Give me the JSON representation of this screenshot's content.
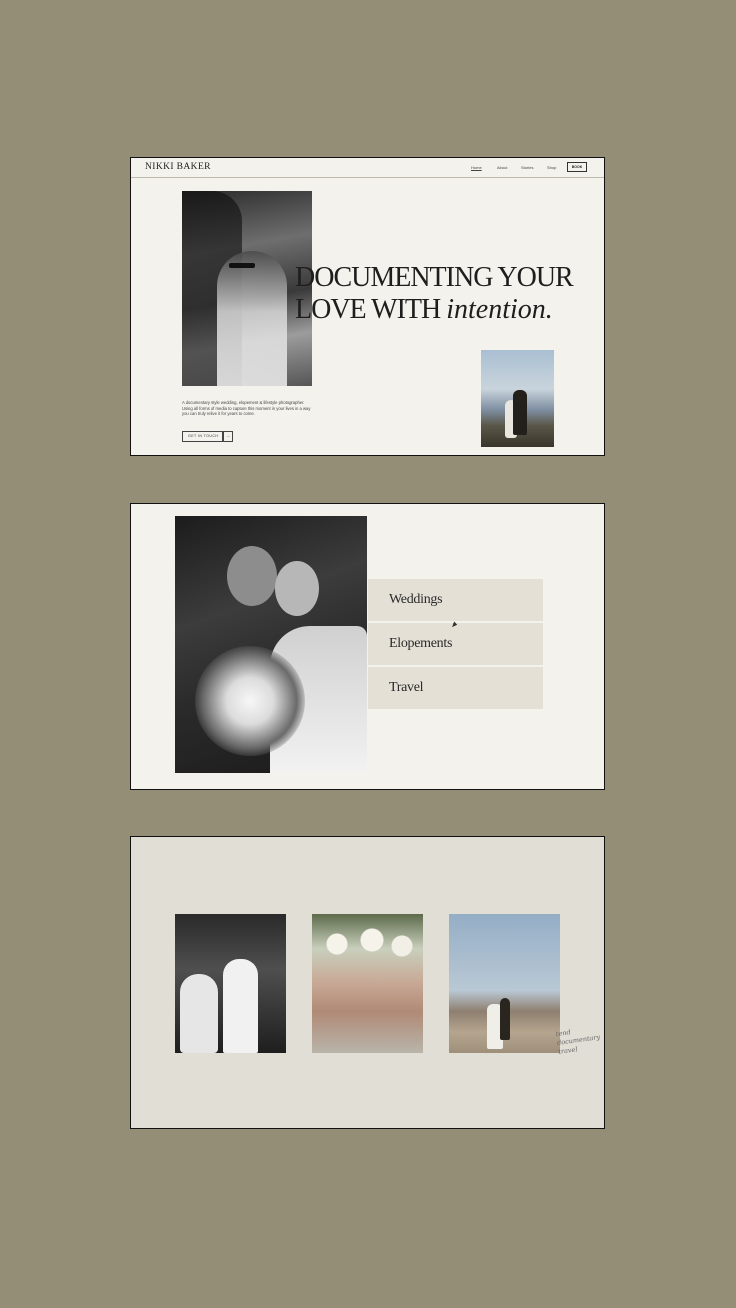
{
  "site": {
    "logo": "NIKKI BAKER",
    "nav": [
      {
        "label": "Home",
        "active": true
      },
      {
        "label": "About",
        "active": false
      },
      {
        "label": "Stories",
        "active": false
      },
      {
        "label": "Shop",
        "active": false
      }
    ],
    "book_label": "BOOK"
  },
  "hero": {
    "headline_line1": "DOCUMENTING YOUR",
    "headline_line2_prefix": "LOVE WITH ",
    "headline_line2_italic": "intention.",
    "intro": "A documentary style wedding, elopement & lifestyle photographer. Using all forms of media to capture this moment in your lives in a way you can truly relive it for years to come.",
    "cta_label": "GET IN TOUCH",
    "cta_arrow": "→"
  },
  "services": {
    "items": [
      {
        "label": "Weddings"
      },
      {
        "label": "Elopements"
      },
      {
        "label": "Travel"
      }
    ]
  },
  "gallery": {
    "signature_lines": [
      "tend",
      "documentary",
      "travel"
    ]
  },
  "colors": {
    "background": "#958e76",
    "card_light": "#f4f2ec",
    "card_gallery": "#e0ded5",
    "menu_item": "#e4e0d6",
    "ink": "#1e1e1e"
  }
}
